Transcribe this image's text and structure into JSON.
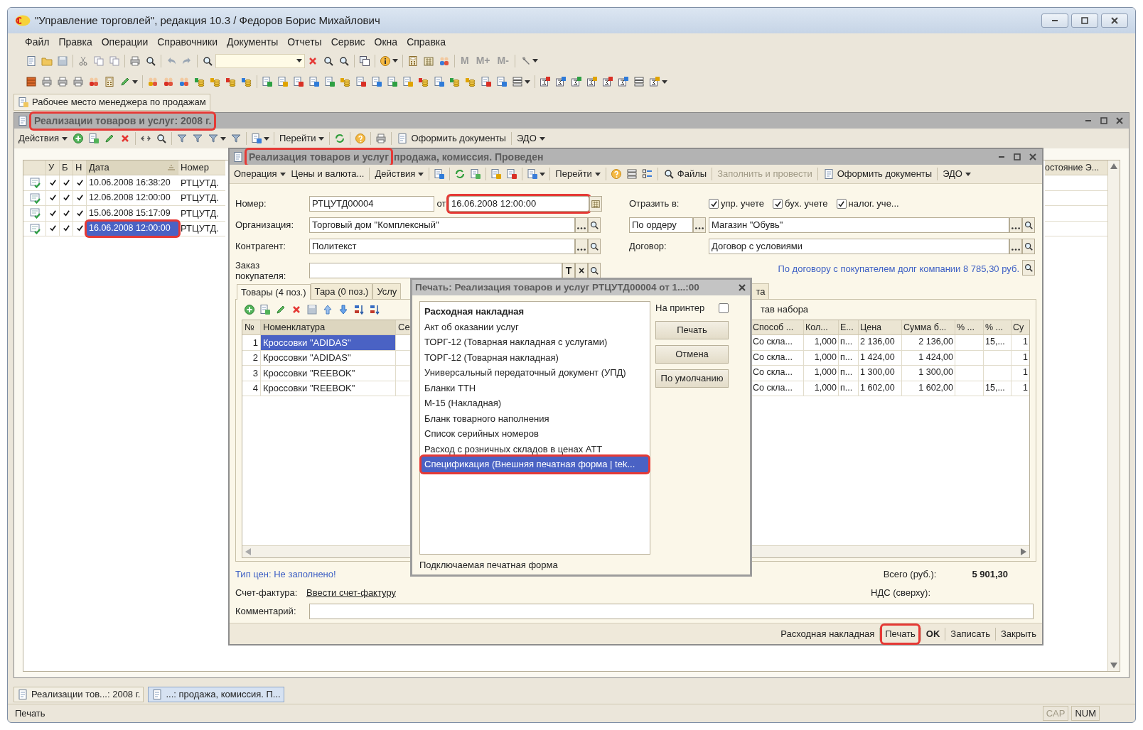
{
  "window": {
    "title": "\"Управление торговлей\", редакция 10.3 / Федоров Борис Михайлович"
  },
  "menu": [
    "Файл",
    "Правка",
    "Операции",
    "Справочники",
    "Документы",
    "Отчеты",
    "Сервис",
    "Окна",
    "Справка"
  ],
  "memory_buttons": [
    "M",
    "M+",
    "M-"
  ],
  "workplace_button": "Рабочее место менеджера по продажам",
  "list_window": {
    "title": "Реализации товаров и услуг: 2008 г.",
    "highlighted": true,
    "toolbar": [
      "Действия",
      "Перейти",
      "Оформить документы",
      "ЭДО"
    ],
    "columns": [
      "У",
      "Б",
      "Н",
      "Дата",
      "Номер"
    ],
    "right_column": "остояние Э...",
    "rows": [
      {
        "u": true,
        "b": true,
        "n": true,
        "date": "10.06.2008 16:38:20",
        "number": "РТЦУТД.",
        "selected": false,
        "highlighted": false
      },
      {
        "u": true,
        "b": true,
        "n": true,
        "date": "12.06.2008 12:00:00",
        "number": "РТЦУТД.",
        "selected": false,
        "highlighted": false
      },
      {
        "u": true,
        "b": true,
        "n": true,
        "date": "15.06.2008 15:17:09",
        "number": "РТЦУТД.",
        "selected": false,
        "highlighted": false
      },
      {
        "u": true,
        "b": true,
        "n": true,
        "date": "16.06.2008 12:00:00",
        "number": "РТЦУТД.",
        "selected": true,
        "highlighted": true
      }
    ]
  },
  "document": {
    "title": "Реализация товаров и услуг",
    "title_rest": "продажа, комиссия. Проведен",
    "title_highlighted": true,
    "toolbar": [
      {
        "label": "Операция",
        "disabled": false
      },
      {
        "label": "Цены и валюта...",
        "disabled": false
      },
      {
        "label": "Действия",
        "disabled": false
      },
      {
        "label": "Перейти",
        "disabled": false
      },
      {
        "label": "Файлы",
        "disabled": false
      },
      {
        "label": "Заполнить и провести",
        "disabled": true
      },
      {
        "label": "Оформить документы",
        "disabled": false
      },
      {
        "label": "ЭДО",
        "disabled": false
      }
    ],
    "number": {
      "label": "Номер:",
      "value": "РТЦУТД00004"
    },
    "date": {
      "label": "от",
      "value": "16.06.2008 12:00:00",
      "highlighted": true
    },
    "organization": {
      "label": "Организация:",
      "value": "Торговый дом \"Комплексный\""
    },
    "counterparty": {
      "label": "Контрагент:",
      "value": "Политекст"
    },
    "order": {
      "label": "Заказ покупателя:",
      "buttons": [
        "T",
        "×"
      ]
    },
    "reflect": {
      "label": "Отразить в:",
      "options": [
        {
          "label": "упр. учете",
          "checked": true
        },
        {
          "label": "бух. учете",
          "checked": true
        },
        {
          "label": "налог. уче...",
          "checked": true
        }
      ]
    },
    "warehouse_mode": "По ордеру",
    "warehouse": "Магазин \"Обувь\"",
    "contract": {
      "label": "Договор:",
      "value": "Договор с условиями"
    },
    "debt_link": "По договору с покупателем долг компании 8 785,30 руб.",
    "tabs": [
      {
        "label": "Товары (4 поз.)",
        "selected": true
      },
      {
        "label": "Тара (0 поз.)",
        "selected": false
      },
      {
        "label": "Услу",
        "selected": false
      },
      {
        "label": "та",
        "selected": false
      }
    ],
    "set_label": "тав набора",
    "goods": {
      "columns_left": [
        "№",
        "Номенклатура",
        "Се"
      ],
      "columns_right": [
        "Способ ...",
        "Кол...",
        "Е...",
        "Цена",
        "Сумма б...",
        "% ...",
        "% ...",
        "Су"
      ],
      "rows": [
        {
          "num": "1",
          "name": "Кроссовки \"ADIDAS\"",
          "selected": true,
          "method": "Со скла...",
          "qty": "1,000",
          "unit": "п...",
          "price": "2 136,00",
          "sum": "2 136,00",
          "pct2": "15,...",
          "last": "1"
        },
        {
          "num": "2",
          "name": "Кроссовки \"ADIDAS\"",
          "selected": false,
          "method": "Со скла...",
          "qty": "1,000",
          "unit": "п...",
          "price": "1 424,00",
          "sum": "1 424,00",
          "last": "1"
        },
        {
          "num": "3",
          "name": "Кроссовки \"REEBOK\"",
          "selected": false,
          "method": "Со скла...",
          "qty": "1,000",
          "unit": "п...",
          "price": "1 300,00",
          "sum": "1 300,00",
          "last": "1"
        },
        {
          "num": "4",
          "name": "Кроссовки \"REEBOK\"",
          "selected": false,
          "method": "Со скла...",
          "qty": "1,000",
          "unit": "п...",
          "price": "1 602,00",
          "sum": "1 602,00",
          "pct2": "15,...",
          "last": "1"
        }
      ]
    },
    "price_type": "Тип цен: Не заполнено!",
    "total": {
      "label": "Всего (руб.):",
      "value": "5 901,30"
    },
    "invoice": {
      "label": "Счет-фактура:",
      "link": "Ввести счет-фактуру"
    },
    "vat": {
      "label": "НДС (сверху):"
    },
    "comment": {
      "label": "Комментарий:"
    },
    "buttons": [
      {
        "label": "Расходная накладная",
        "default": false,
        "highlighted": false
      },
      {
        "label": "Печать",
        "default": false,
        "highlighted": true
      },
      {
        "label": "OK",
        "default": true,
        "highlighted": false
      },
      {
        "label": "Записать",
        "default": false,
        "highlighted": false
      },
      {
        "label": "Закрыть",
        "default": false,
        "highlighted": false
      }
    ]
  },
  "print_dialog": {
    "title": "Печать: Реализация товаров и услуг РТЦУТД00004 от 1...:00",
    "items": [
      {
        "label": "Расходная накладная",
        "default": true,
        "selected": false,
        "highlighted": false
      },
      {
        "label": "Акт об оказании услуг",
        "default": false,
        "selected": false,
        "highlighted": false
      },
      {
        "label": "ТОРГ-12 (Товарная накладная с услугами)",
        "default": false,
        "selected": false,
        "highlighted": false
      },
      {
        "label": "ТОРГ-12 (Товарная накладная)",
        "default": false,
        "selected": false,
        "highlighted": false
      },
      {
        "label": "Универсальный передаточный документ (УПД)",
        "default": false,
        "selected": false,
        "highlighted": false
      },
      {
        "label": "Бланки ТТН",
        "default": false,
        "selected": false,
        "highlighted": false
      },
      {
        "label": "М-15 (Накладная)",
        "default": false,
        "selected": false,
        "highlighted": false
      },
      {
        "label": "Бланк товарного наполнения",
        "default": false,
        "selected": false,
        "highlighted": false
      },
      {
        "label": "Список серийных номеров",
        "default": false,
        "selected": false,
        "highlighted": false
      },
      {
        "label": "Расход с розничных складов в ценах АТТ",
        "default": false,
        "selected": false,
        "highlighted": false
      },
      {
        "label": "Спецификация (Внешняя печатная форма | tek...",
        "default": false,
        "selected": true,
        "highlighted": true
      }
    ],
    "to_printer": {
      "label": "На принтер",
      "checked": false
    },
    "buttons": [
      "Печать",
      "Отмена",
      "По умолчанию"
    ],
    "footer": "Подключаемая печатная форма"
  },
  "taskbar": [
    {
      "label": "Реализации тов...: 2008 г.",
      "selected": false
    },
    {
      "label": "...: продажа, комиссия. П...",
      "selected": true
    }
  ],
  "status_bar": {
    "text": "Печать",
    "indicators": [
      {
        "label": "CAP",
        "on": false
      },
      {
        "label": "NUM",
        "on": true
      }
    ]
  }
}
